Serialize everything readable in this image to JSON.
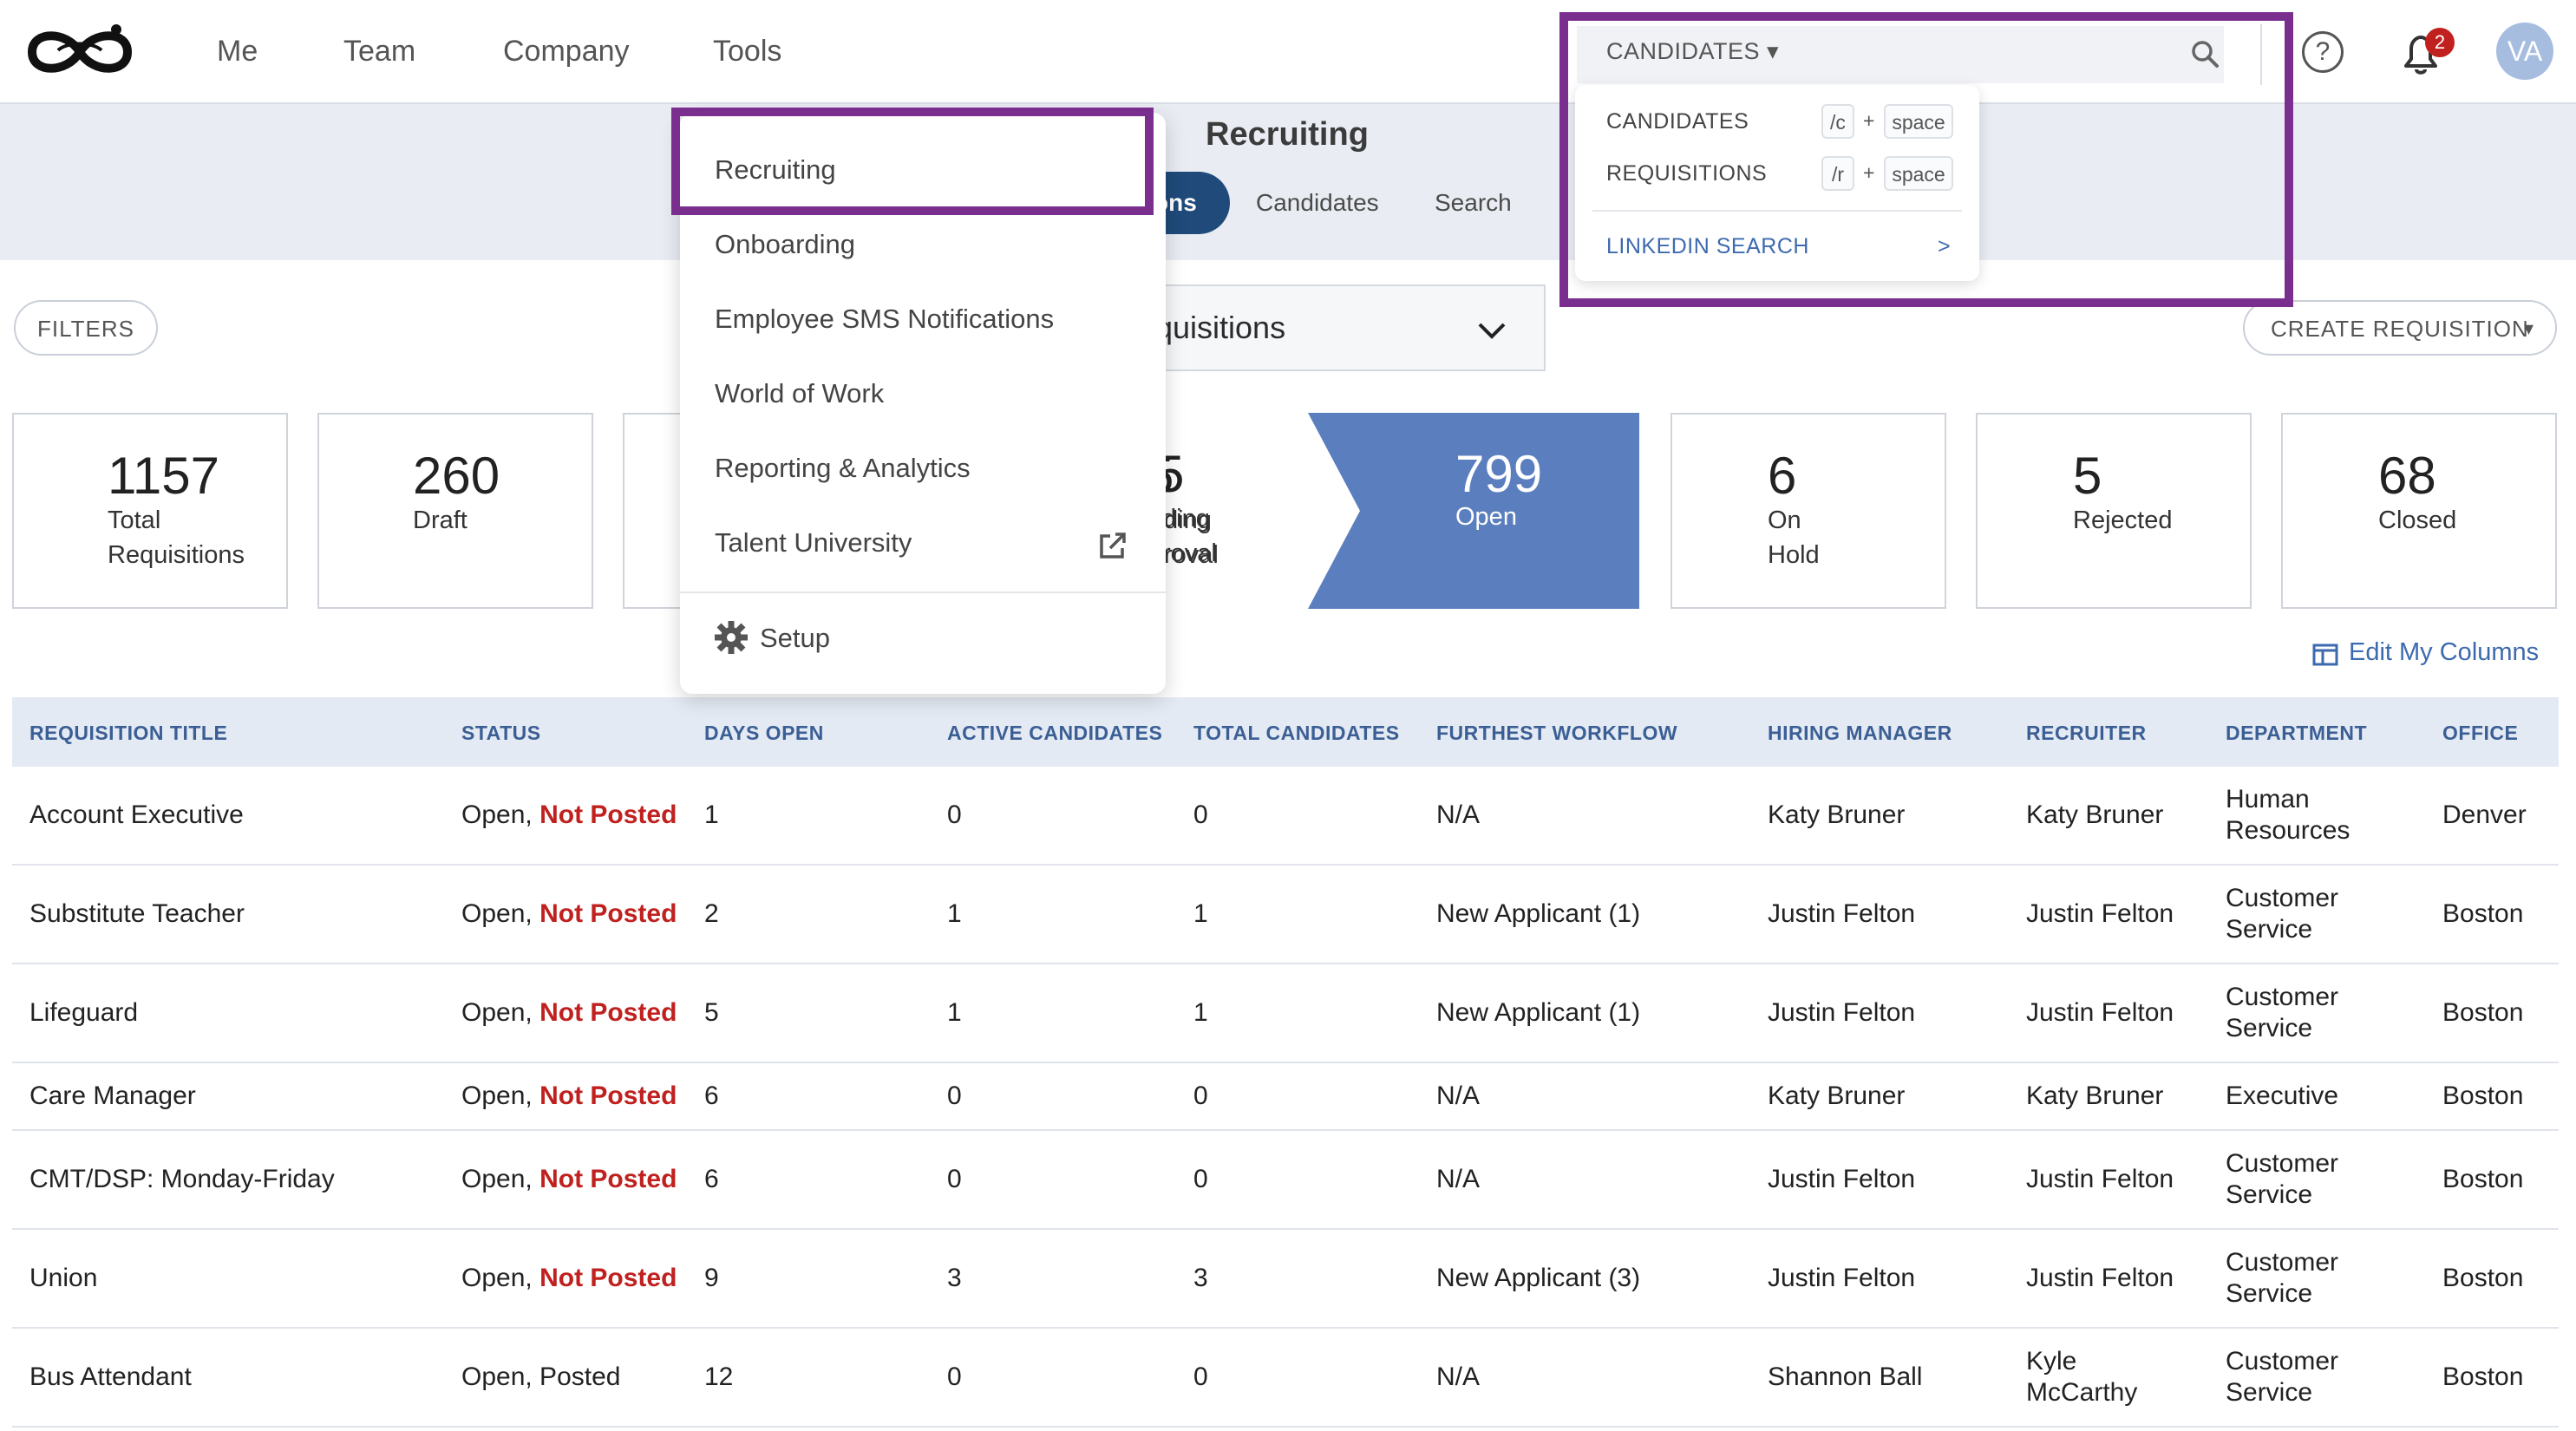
{
  "nav": {
    "items": [
      "Me",
      "Team",
      "Company",
      "Tools"
    ]
  },
  "search": {
    "type_label": "CANDIDATES",
    "dropdown": {
      "candidates": {
        "label": "CANDIDATES",
        "key": "/c",
        "plus": "+",
        "space": "space"
      },
      "requisitions": {
        "label": "REQUISITIONS",
        "key": "/r",
        "plus": "+",
        "space": "space"
      },
      "linkedin": {
        "label": "LINKEDIN SEARCH",
        "arrow": ">"
      }
    }
  },
  "header": {
    "notification_count": "2",
    "avatar_initials": "VA",
    "help_glyph": "?"
  },
  "page": {
    "title": "Recruiting",
    "tabs": {
      "active_visible": "ons",
      "candidates": "Candidates",
      "search": "Search"
    },
    "filters_label": "FILTERS",
    "view_select_visible": "quisitions",
    "create_label": "CREATE REQUISITION",
    "edit_columns_label": "Edit My Columns"
  },
  "tools_menu": {
    "items": [
      "Recruiting",
      "Onboarding",
      "Employee SMS Notifications",
      "World of Work",
      "Reporting & Analytics",
      "Talent University"
    ],
    "setup_label": "Setup"
  },
  "stats": {
    "total": {
      "value": "1157",
      "l1": "Total",
      "l2": "Requisitions"
    },
    "draft": {
      "value": "260",
      "l1": "Draft"
    },
    "pending": {
      "value": "5",
      "l1": "ding",
      "l2": "roval"
    },
    "open": {
      "value": "799",
      "l1": "Open"
    },
    "on_hold": {
      "value": "6",
      "l1": "On",
      "l2": "Hold"
    },
    "rejected": {
      "value": "5",
      "l1": "Rejected"
    },
    "closed": {
      "value": "68",
      "l1": "Closed"
    }
  },
  "table": {
    "headers": [
      "REQUISITION TITLE",
      "STATUS",
      "DAYS OPEN",
      "ACTIVE CANDIDATES",
      "TOTAL CANDIDATES",
      "FURTHEST WORKFLOW",
      "HIRING MANAGER",
      "RECRUITER",
      "DEPARTMENT",
      "OFFICE"
    ],
    "rows": [
      {
        "title": "Account Executive",
        "status_a": "Open,",
        "status_b": "Not Posted",
        "days": "1",
        "active": "0",
        "total": "0",
        "workflow": "N/A",
        "manager": "Katy Bruner",
        "recruiter": "Katy Bruner",
        "dept1": "Human",
        "dept2": "Resources",
        "office": "Denver"
      },
      {
        "title": "Substitute Teacher",
        "status_a": "Open,",
        "status_b": "Not Posted",
        "days": "2",
        "active": "1",
        "total": "1",
        "workflow": "New Applicant (1)",
        "manager": "Justin Felton",
        "recruiter": "Justin Felton",
        "dept1": "Customer",
        "dept2": "Service",
        "office": "Boston"
      },
      {
        "title": "Lifeguard",
        "status_a": "Open,",
        "status_b": "Not Posted",
        "days": "5",
        "active": "1",
        "total": "1",
        "workflow": "New Applicant (1)",
        "manager": "Justin Felton",
        "recruiter": "Justin Felton",
        "dept1": "Customer",
        "dept2": "Service",
        "office": "Boston"
      },
      {
        "title": "Care Manager",
        "status_a": "Open,",
        "status_b": "Not Posted",
        "days": "6",
        "active": "0",
        "total": "0",
        "workflow": "N/A",
        "manager": "Katy Bruner",
        "recruiter": "Katy Bruner",
        "dept1": "Executive",
        "dept2": "",
        "office": "Boston"
      },
      {
        "title": "CMT/DSP: Monday-Friday",
        "status_a": "Open,",
        "status_b": "Not Posted",
        "days": "6",
        "active": "0",
        "total": "0",
        "workflow": "N/A",
        "manager": "Justin Felton",
        "recruiter": "Justin Felton",
        "dept1": "Customer",
        "dept2": "Service",
        "office": "Boston"
      },
      {
        "title": "Union",
        "status_a": "Open,",
        "status_b": "Not Posted",
        "days": "9",
        "active": "3",
        "total": "3",
        "workflow": "New Applicant (3)",
        "manager": "Justin Felton",
        "recruiter": "Justin Felton",
        "dept1": "Customer",
        "dept2": "Service",
        "office": "Boston"
      },
      {
        "title": "Bus Attendant",
        "status_a": "Open, Posted",
        "status_b": "",
        "days": "12",
        "active": "0",
        "total": "0",
        "workflow": "N/A",
        "manager": "Shannon Ball",
        "recruiter1": "Kyle",
        "recruiter2": "McCarthy",
        "dept1": "Customer",
        "dept2": "Service",
        "office": "Boston"
      }
    ]
  },
  "colors": {
    "highlight": "#7a2f8e",
    "nav_dark": "#1f4a7a",
    "open_card": "#5b7fbe",
    "not_posted": "#c0211f",
    "header_text": "#3b5f95"
  }
}
